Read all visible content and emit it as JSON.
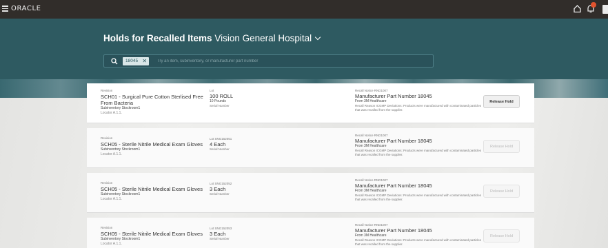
{
  "header": {
    "brand": "ORACLE",
    "icons": [
      "hamburger-menu-icon",
      "home-icon",
      "notifications-bell-icon"
    ],
    "colors": {
      "topbar": "#312d2a",
      "hero": "#2e5a61",
      "notification_dot": "#e2532e"
    }
  },
  "page": {
    "title_bold": "Holds for Recalled Items",
    "location": "Vision General Hospital"
  },
  "search": {
    "chip": "18045",
    "placeholder": "Try an item, subinventory, or manufacturer part number"
  },
  "holds": [
    {
      "revision_label": "Revision",
      "item": "SCH01 - Surgical Pure Cotton Sterlised Free From Bacteria",
      "subinventory": "Subinventory Stockroom1",
      "locator": "Locator A.1.1.",
      "lot": "Lot",
      "qty": "100 ROLL",
      "secondary_qty": "10 Pounds",
      "serial_label": "Serial Number",
      "recall_notice": "Recall Notice RND1007",
      "part": "Manufacturer Part Number 18045",
      "from": "From 3M Healthcare",
      "reason": "Recall Reason ICGMP Deviations: Products were manufactured with contaminated particles that was recalled from the supplier.",
      "button": "Release Hold",
      "enabled": true
    },
    {
      "revision_label": "Revision",
      "item": "SCH05 - Sterile Nitrile Medical Exam Gloves",
      "subinventory": "Subinventory Stockroom1",
      "locator": "Locator A.1.1.",
      "lot": "Lot SNG152051",
      "qty": "4 Each",
      "secondary_qty": "",
      "serial_label": "Serial Number",
      "recall_notice": "Recall Notice RND1007",
      "part": "Manufacturer Part Number 18045",
      "from": "From 3M Healthcare",
      "reason": "Recall Reason ICGMP Deviations: Products were manufactured with contaminated particles that was recalled from the supplier.",
      "button": "Release Hold",
      "enabled": false
    },
    {
      "revision_label": "Revision",
      "item": "SCH05 - Sterile Nitrile Medical Exam Gloves",
      "subinventory": "Subinventory Stockroom1",
      "locator": "Locator A.1.1.",
      "lot": "Lot SNG152052",
      "qty": "3 Each",
      "secondary_qty": "",
      "serial_label": "Serial Number",
      "recall_notice": "Recall Notice RND1007",
      "part": "Manufacturer Part Number 18045",
      "from": "From 3M Healthcare",
      "reason": "Recall Reason ICGMP Deviations: Products were manufactured with contaminated particles that was recalled from the supplier.",
      "button": "Release Hold",
      "enabled": false
    },
    {
      "revision_label": "Revision",
      "item": "SCH05 - Sterile Nitrile Medical Exam Gloves",
      "subinventory": "Subinventory Stockroom1",
      "locator": "Locator A.1.1.",
      "lot": "Lot SNG152053",
      "qty": "3 Each",
      "secondary_qty": "",
      "serial_label": "Serial Number",
      "recall_notice": "Recall Notice RND1007",
      "part": "Manufacturer Part Number 18045",
      "from": "From 3M Healthcare",
      "reason": "Recall Reason ICGMP Deviations: Products were manufactured with contaminated particles that was recalled from the supplier.",
      "button": "Release Hold",
      "enabled": false
    }
  ]
}
